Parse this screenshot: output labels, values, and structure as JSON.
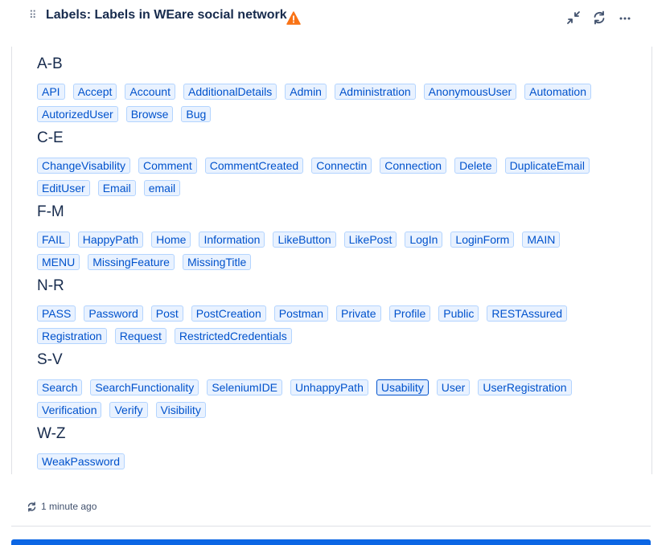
{
  "header": {
    "title": "Labels: Labels in WEare social network",
    "icons": [
      "drag-handle-icon",
      "warning-icon",
      "collapse-icon",
      "refresh-icon",
      "more-icon"
    ],
    "warning_color": "#f97316"
  },
  "groups": [
    {
      "heading": "A-B",
      "rows": [
        [
          "API",
          "Accept",
          "Account",
          "AdditionalDetails",
          "Admin",
          "Administration",
          "AnonymousUser",
          "Automation"
        ],
        [
          "AutorizedUser",
          "Browse",
          "Bug"
        ]
      ]
    },
    {
      "heading": "C-E",
      "rows": [
        [
          "ChangeVisability",
          "Comment",
          "CommentCreated",
          "Connectin",
          "Connection",
          "Delete",
          "DuplicateEmail"
        ],
        [
          "EditUser",
          "Email",
          "email"
        ]
      ]
    },
    {
      "heading": "F-M",
      "rows": [
        [
          "FAIL",
          "HappyPath",
          "Home",
          "Information",
          "LikeButton",
          "LikePost",
          "LogIn",
          "LoginForm",
          "MAIN"
        ],
        [
          "MENU",
          "MissingFeature",
          "MissingTitle"
        ]
      ]
    },
    {
      "heading": "N-R",
      "rows": [
        [
          "PASS",
          "Password",
          "Post",
          "PostCreation",
          "Postman",
          "Private",
          "Profile",
          "Public",
          "RESTAssured"
        ],
        [
          "Registration",
          "Request",
          "RestrictedCredentials"
        ]
      ]
    },
    {
      "heading": "S-V",
      "rows": [
        [
          "Search",
          "SearchFunctionality",
          "SeleniumIDE",
          "UnhappyPath",
          "Usability",
          "User",
          "UserRegistration"
        ],
        [
          "Verification",
          "Verify",
          "Visibility"
        ]
      ]
    },
    {
      "heading": "W-Z",
      "rows": [
        [
          "WeakPassword"
        ]
      ]
    }
  ],
  "focused_label": "Usability",
  "footer": {
    "timestamp": "1 minute ago"
  },
  "colors": {
    "label_text": "#0052cc",
    "label_bg": "#e9f2ff",
    "accent_bar": "#0c66e4"
  }
}
